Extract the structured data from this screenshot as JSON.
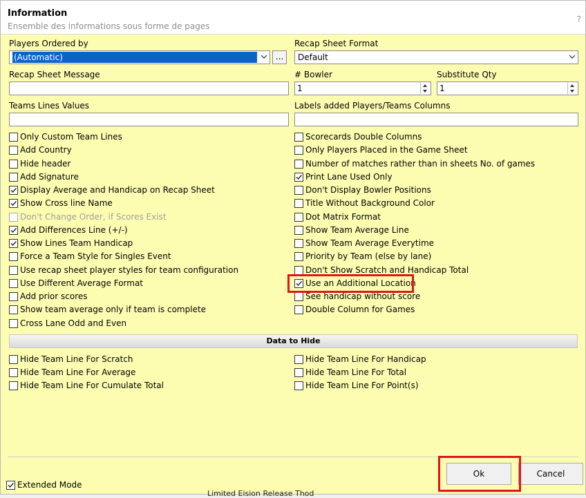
{
  "dialog": {
    "title": "Information",
    "subtitle": "Ensemble des informations sous forme de pages",
    "help": "?"
  },
  "fields": {
    "players_ordered_by": {
      "label": "Players Ordered by",
      "value": "(Automatic)",
      "more": "..."
    },
    "recap_sheet_format": {
      "label": "Recap Sheet Format",
      "value": "Default"
    },
    "recap_sheet_message": {
      "label": "Recap Sheet Message",
      "value": ""
    },
    "bowler": {
      "label": "# Bowler",
      "value": "1"
    },
    "substitute_qty": {
      "label": "Substitute Qty",
      "value": "1"
    },
    "teams_lines_values": {
      "label": "Teams Lines Values",
      "value": ""
    },
    "labels_added": {
      "label": "Labels added Players/Teams Columns",
      "value": ""
    }
  },
  "left_options": [
    {
      "label": "Only Custom Team Lines",
      "checked": false
    },
    {
      "label": "Add Country",
      "checked": false
    },
    {
      "label": "Hide header",
      "checked": false
    },
    {
      "label": "Add Signature",
      "checked": false
    },
    {
      "label": "Display Average and Handicap on Recap Sheet",
      "checked": true
    },
    {
      "label": "Show Cross line Name",
      "checked": true
    },
    {
      "label": "Don't Change Order, if Scores Exist",
      "checked": false,
      "disabled": true
    },
    {
      "label": "Add Differences Line (+/-)",
      "checked": true
    },
    {
      "label": "Show Lines Team Handicap",
      "checked": true
    },
    {
      "label": "Force a Team Style for Singles Event",
      "checked": false
    },
    {
      "label": "Use recap sheet player styles for team configuration",
      "checked": false
    },
    {
      "label": "Use Different Average Format",
      "checked": false
    },
    {
      "label": "Add prior scores",
      "checked": false
    },
    {
      "label": "Show team average only if team is complete",
      "checked": false
    },
    {
      "label": "Cross Lane Odd and Even",
      "checked": false
    }
  ],
  "right_options": [
    {
      "label": "Scorecards Double Columns",
      "checked": false
    },
    {
      "label": "Only Players Placed in the Game Sheet",
      "checked": false
    },
    {
      "label": "Number of matches rather than in sheets No. of games",
      "checked": false
    },
    {
      "label": "Print Lane Used Only",
      "checked": true
    },
    {
      "label": "Don't Display Bowler Positions",
      "checked": false
    },
    {
      "label": "Title Without Background Color",
      "checked": false
    },
    {
      "label": "Dot Matrix Format",
      "checked": false
    },
    {
      "label": "Show Team Average Line",
      "checked": false
    },
    {
      "label": "Show Team Average Everytime",
      "checked": false
    },
    {
      "label": "Priority by Team (else by lane)",
      "checked": false
    },
    {
      "label": "Don't Show Scratch and Handicap Total",
      "checked": false
    },
    {
      "label": "Use an Additional Location",
      "checked": true
    },
    {
      "label": "See handicap without score",
      "checked": false
    },
    {
      "label": "Double Column for Games",
      "checked": false
    }
  ],
  "hide_section": {
    "title": "Data to Hide",
    "left": [
      {
        "label": "Hide Team Line For Scratch",
        "checked": false
      },
      {
        "label": "Hide Team Line For Average",
        "checked": false
      },
      {
        "label": "Hide Team Line For Cumulate Total",
        "checked": false
      }
    ],
    "right": [
      {
        "label": "Hide Team Line For Handicap",
        "checked": false
      },
      {
        "label": "Hide Team Line For Total",
        "checked": false
      },
      {
        "label": "Hide Team Line For Point(s)",
        "checked": false
      }
    ]
  },
  "footer": {
    "extended_mode": {
      "label": "Extended Mode",
      "checked": true
    },
    "ok_label": "Ok",
    "cancel_label": "Cancel"
  },
  "background_text": "Limited                 Eision Release Thod",
  "colors": {
    "dialog_bg": "#fdfdb2",
    "selection": "#0a64c8",
    "highlight": "#e0141c"
  }
}
